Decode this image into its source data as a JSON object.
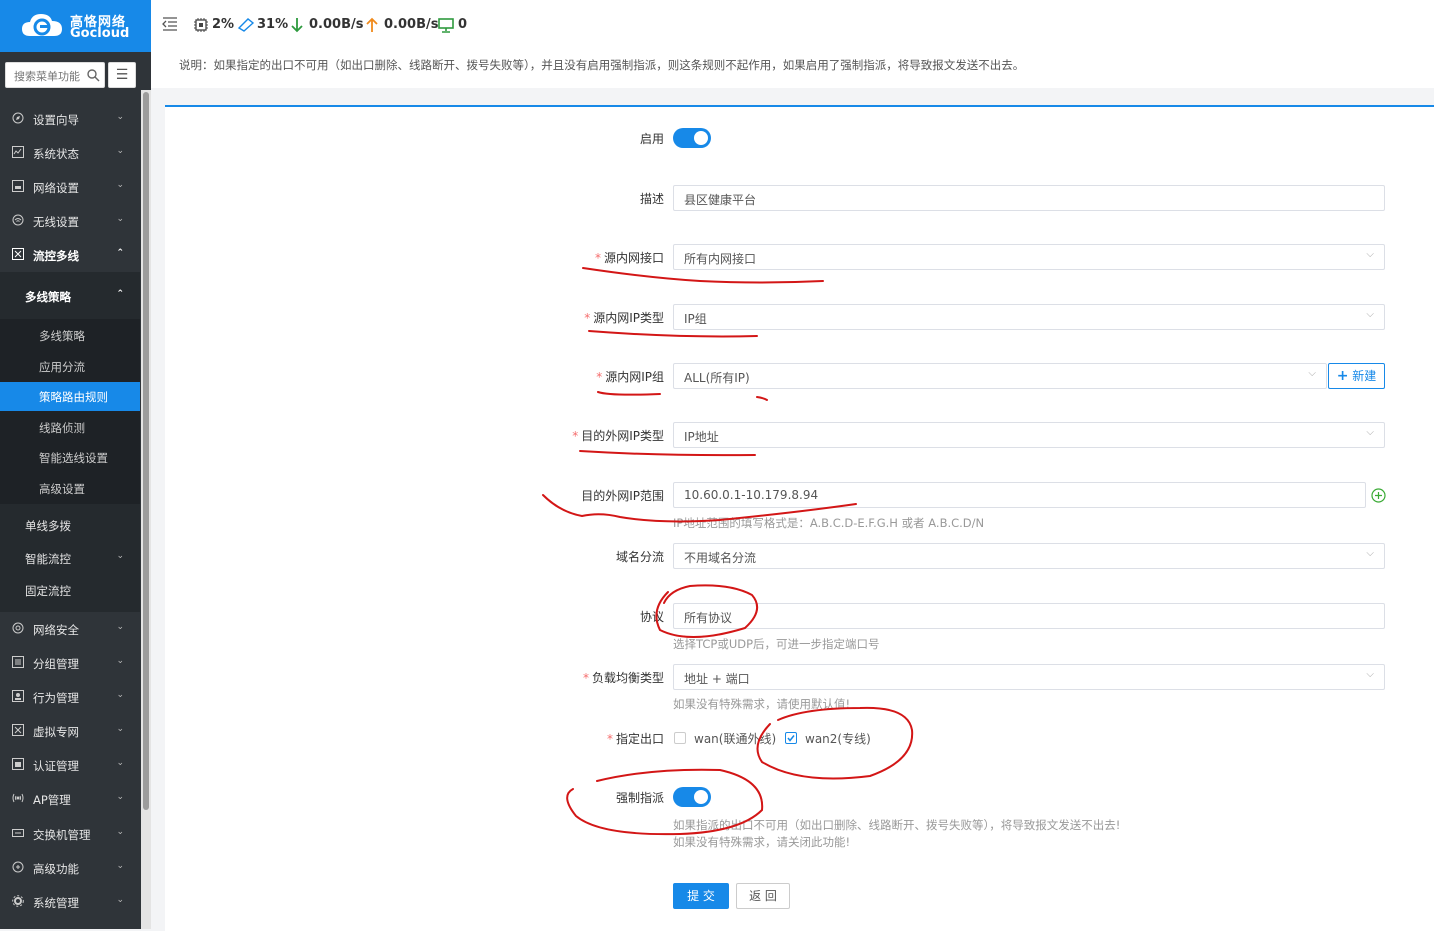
{
  "brand": {
    "name_cn": "高恪网络",
    "name_en": "Gocloud",
    "color": "#1789e8"
  },
  "sidebar": {
    "search_placeholder": "搜索菜单功能",
    "items": [
      {
        "label": "设置向导",
        "icon": "compass-icon"
      },
      {
        "label": "系统状态",
        "icon": "chart-icon"
      },
      {
        "label": "网络设置",
        "icon": "network-icon"
      },
      {
        "label": "无线设置",
        "icon": "wifi-icon"
      },
      {
        "label": "流控多线",
        "icon": "flow-icon"
      },
      {
        "label": "多线策略"
      },
      {
        "label": "多线策略"
      },
      {
        "label": "应用分流"
      },
      {
        "label": "策略路由规则"
      },
      {
        "label": "线路侦测"
      },
      {
        "label": "智能选线设置"
      },
      {
        "label": "高级设置"
      },
      {
        "label": "单线多拨"
      },
      {
        "label": "智能流控"
      },
      {
        "label": "固定流控"
      },
      {
        "label": "网络安全",
        "icon": "security-icon"
      },
      {
        "label": "分组管理",
        "icon": "group-icon"
      },
      {
        "label": "行为管理",
        "icon": "behavior-icon"
      },
      {
        "label": "虚拟专网",
        "icon": "vpn-icon"
      },
      {
        "label": "认证管理",
        "icon": "auth-icon"
      },
      {
        "label": "AP管理",
        "icon": "ap-icon"
      },
      {
        "label": "交换机管理",
        "icon": "switch-icon"
      },
      {
        "label": "高级功能",
        "icon": "advanced-icon"
      },
      {
        "label": "系统管理",
        "icon": "gear-icon"
      }
    ]
  },
  "topbar": {
    "cpu": "2%",
    "mem": "31%",
    "down": "0.00B/s",
    "up": "0.00B/s",
    "clients": "0"
  },
  "notice": "说明：如果指定的出口不可用（如出口删除、线路断开、拨号失败等），并且没有启用强制指派，则这条规则不起作用，如果启用了强制指派，将导致报文发送不出去。",
  "form": {
    "enable_label": "启用",
    "desc_label": "描述",
    "desc_value": "县区健康平台",
    "src_if_label": "源内网接口",
    "src_if_value": "所有内网接口",
    "src_ip_type_label": "源内网IP类型",
    "src_ip_type_value": "IP组",
    "src_ip_group_label": "源内网IP组",
    "src_ip_group_value": "ALL(所有IP)",
    "new_button": "新建",
    "dst_ip_type_label": "目的外网IP类型",
    "dst_ip_type_value": "IP地址",
    "dst_ip_range_label": "目的外网IP范围",
    "dst_ip_range_value": "10.60.0.1-10.179.8.94",
    "dst_ip_range_hint": "IP地址范围的填写格式是：A.B.C.D-E.F.G.H 或者 A.B.C.D/N",
    "domain_label": "域名分流",
    "domain_value": "不用域名分流",
    "protocol_label": "协议",
    "protocol_value": "所有协议",
    "protocol_hint": "选择TCP或UDP后，可进一步指定端口号",
    "lb_label": "负载均衡类型",
    "lb_value": "地址 + 端口",
    "lb_hint": "如果没有特殊需求，请使用默认值!",
    "exit_label": "指定出口",
    "exit_options": [
      {
        "label": "wan(联通外线)",
        "checked": false
      },
      {
        "label": "wan2(专线)",
        "checked": true
      }
    ],
    "force_label": "强制指派",
    "force_hint1": "如果指派的出口不可用（如出口删除、线路断开、拨号失败等），将导致报文发送不出去!",
    "force_hint2": "如果没有特殊需求，请关闭此功能!",
    "submit": "提 交",
    "back": "返 回"
  }
}
